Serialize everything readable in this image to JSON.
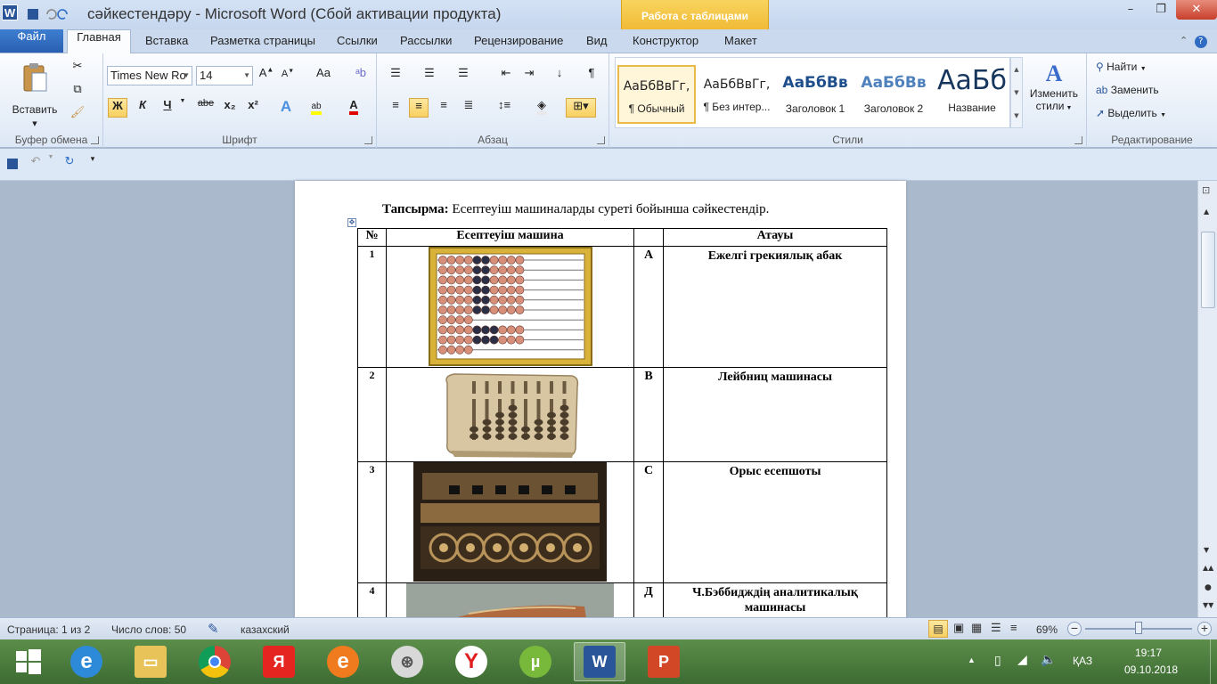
{
  "window": {
    "title": "сәйкестендәру  -  Microsoft Word (Сбой активации продукта)",
    "contextual_tab": "Работа с таблицами",
    "minimize_label": "–",
    "maximize_label": "❐",
    "close_label": "✕"
  },
  "tabs": {
    "file": "Файл",
    "home": "Главная",
    "items": [
      "Вставка",
      "Разметка страницы",
      "Ссылки",
      "Рассылки",
      "Рецензирование",
      "Вид",
      "Конструктор",
      "Макет"
    ]
  },
  "ribbon": {
    "clipboard": {
      "label": "Буфер обмена",
      "paste": "Вставить"
    },
    "font": {
      "label": "Шрифт",
      "font_name": "Times New Ro",
      "font_size": "14",
      "bold": "Ж",
      "italic": "К",
      "underline": "Ч",
      "strike": "abe",
      "sub": "x₂",
      "sup": "x²",
      "case": "Aa"
    },
    "paragraph": {
      "label": "Абзац"
    },
    "styles": {
      "label": "Стили",
      "items": [
        {
          "sample": "АаБбВвГг,",
          "name": "¶ Обычный"
        },
        {
          "sample": "АаБбВвГг,",
          "name": "¶ Без интер..."
        },
        {
          "sample": "АаБбВв",
          "name": "Заголовок 1"
        },
        {
          "sample": "АаБбВв",
          "name": "Заголовок 2"
        },
        {
          "sample": "АаБб",
          "name": "Название"
        }
      ],
      "change_styles_line1": "Изменить",
      "change_styles_line2": "стили"
    },
    "editing": {
      "label": "Редактирование",
      "find": "Найти",
      "replace": "Заменить",
      "select": "Выделить"
    }
  },
  "document": {
    "task_label": "Тапсырма:",
    "task_text": " Есептеуіш машиналарды суреті бойынша сәйкестендір.",
    "table": {
      "headers": [
        "№",
        "Есептеуіш машина",
        "",
        "Атауы"
      ],
      "rows": [
        {
          "num": "1",
          "letter": "А",
          "name": "Ежелгі грекиялық абак"
        },
        {
          "num": "2",
          "letter": "В",
          "name": "Лейбниц машинасы"
        },
        {
          "num": "3",
          "letter": "С",
          "name": "Орыс есепшоты"
        },
        {
          "num": "4",
          "letter": "Д",
          "name": "Ч.Бэббидждің аналитикалық машинасы"
        }
      ]
    }
  },
  "status": {
    "page": "Страница: 1 из 2",
    "words": "Число слов: 50",
    "language": "казахский",
    "zoom": "69%",
    "zoom_fraction": 0.5
  },
  "taskbar": {
    "apps": [
      "start",
      "internet-explorer",
      "file-explorer",
      "chrome",
      "yandex",
      "edge-orange",
      "media-player",
      "yandex-browser",
      "utorrent",
      "word",
      "powerpoint"
    ],
    "language": "ҚАЗ",
    "time": "19:17",
    "date": "09.10.2018"
  }
}
